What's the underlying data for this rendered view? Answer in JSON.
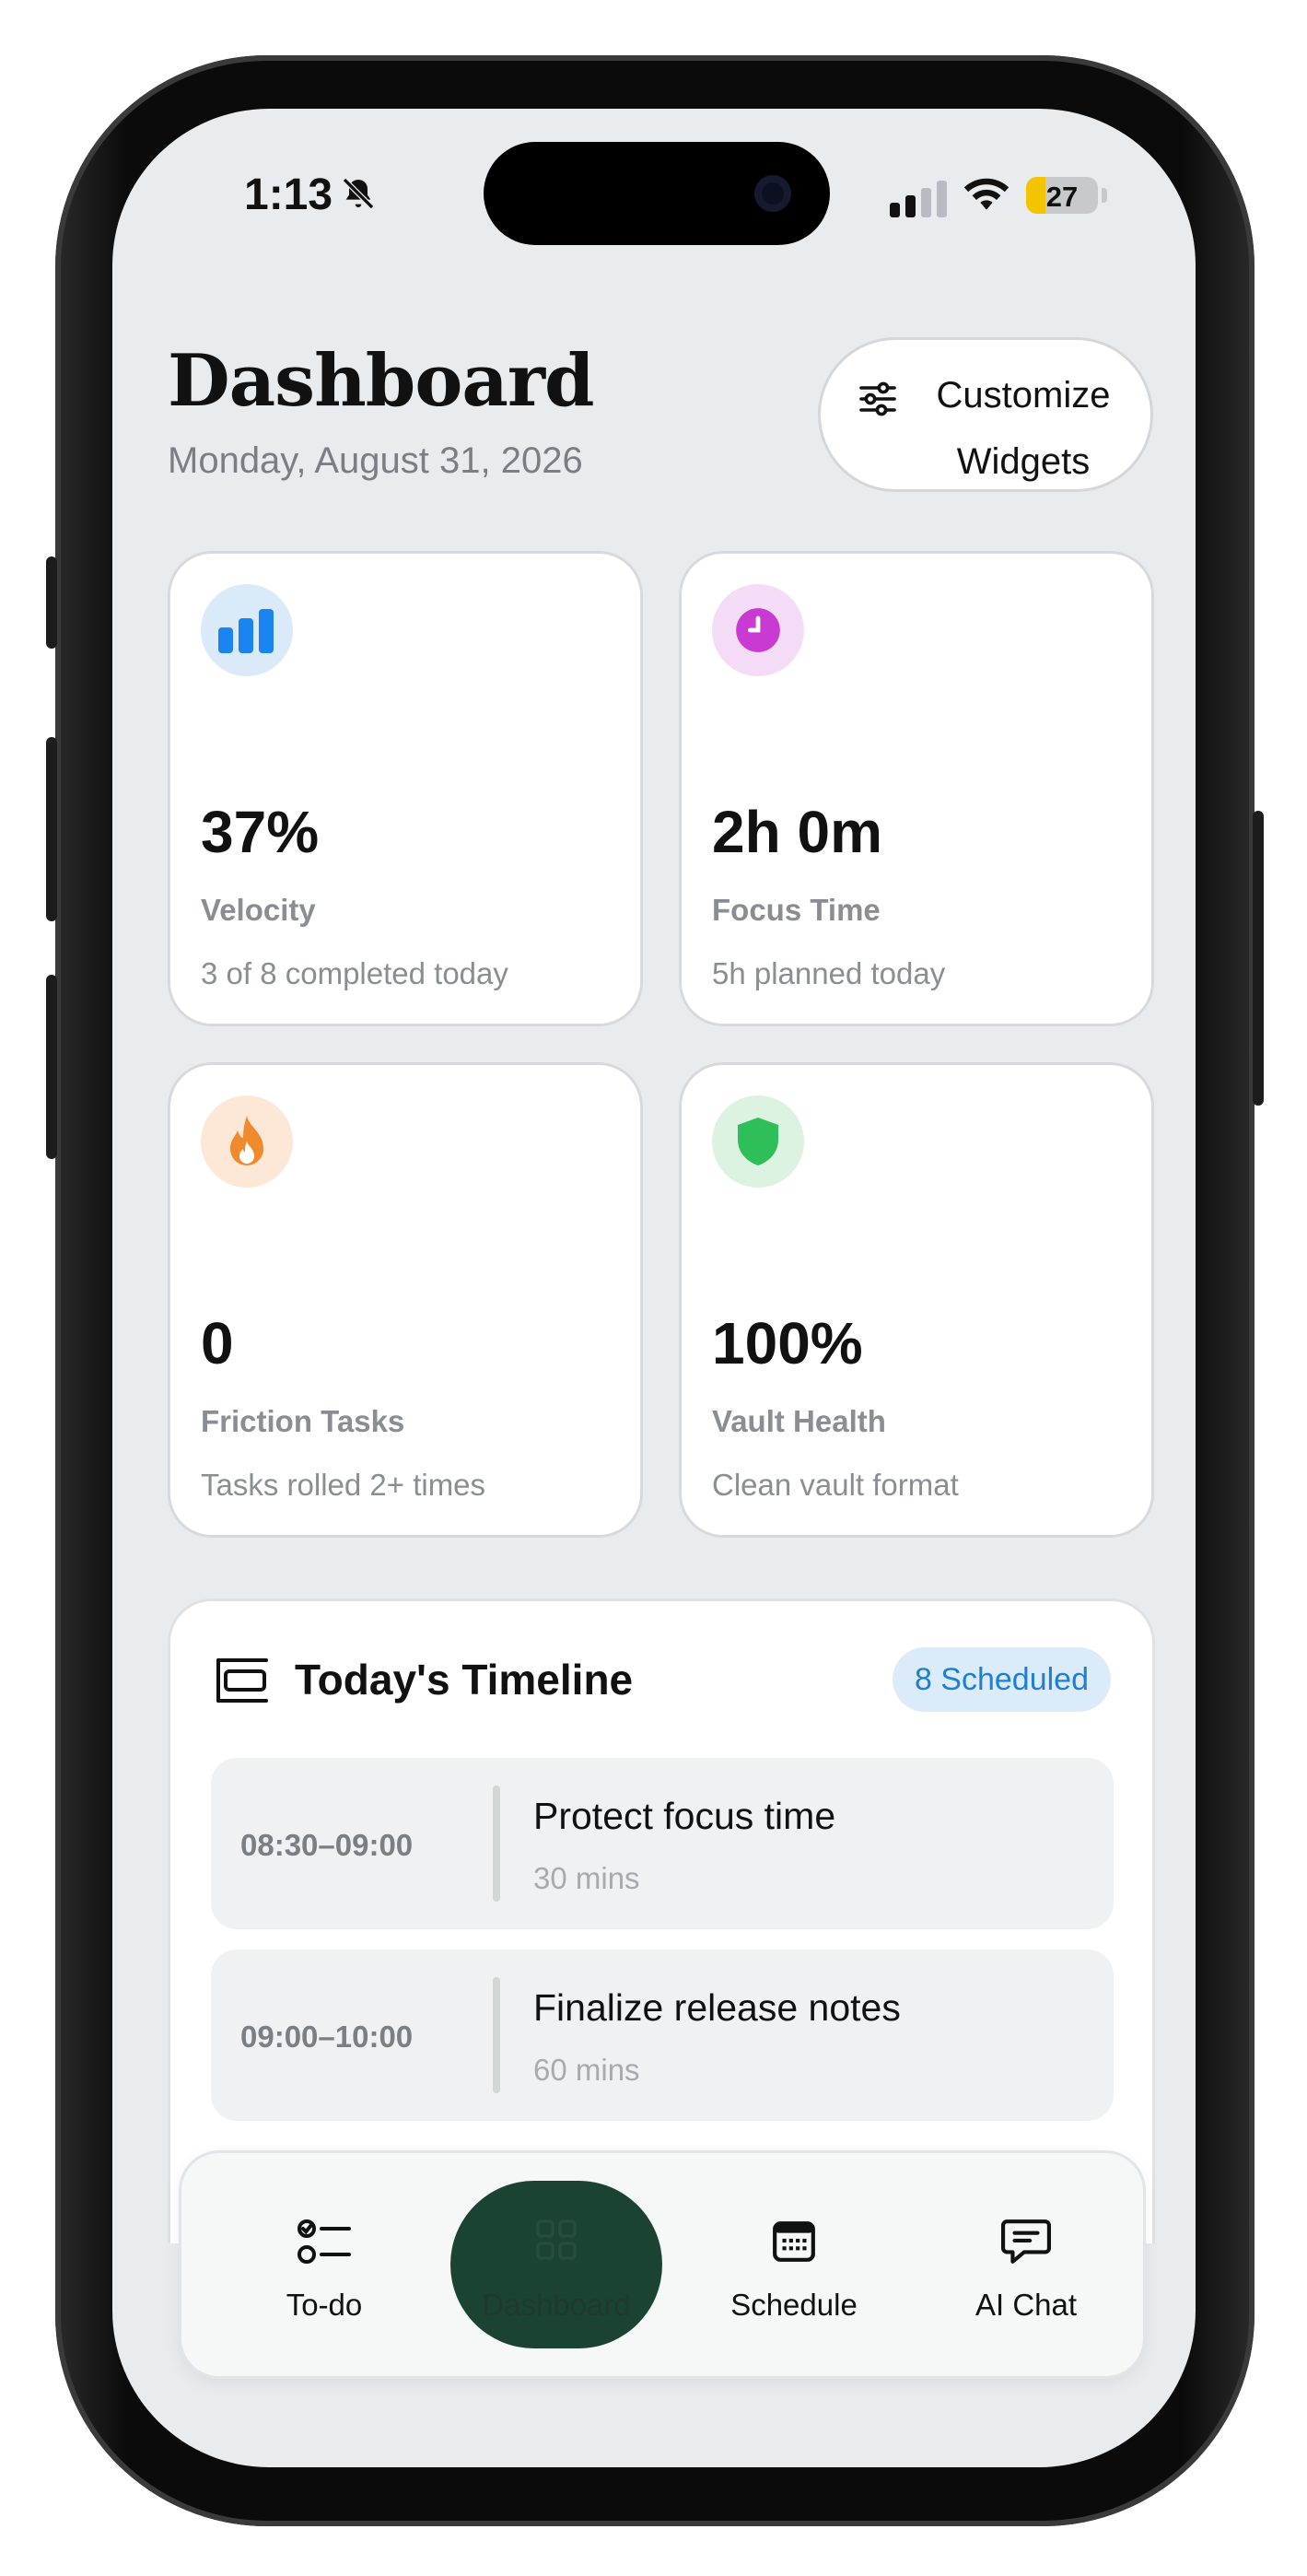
{
  "status_bar": {
    "time": "1:13",
    "battery": "27",
    "battery_fraction": 0.27,
    "icons": [
      "bell-muted-icon",
      "cellular-signal-icon",
      "wifi-icon",
      "battery-icon"
    ]
  },
  "header": {
    "title": "Dashboard",
    "date": "Monday, August 31, 2026",
    "customize_label": "Customize Widgets"
  },
  "cards": [
    {
      "value": "37%",
      "label": "Velocity",
      "sub": "3 of 8 completed today",
      "icon": "bar-chart-icon",
      "accent": "#1a84f0",
      "tint": "#dbeaf9"
    },
    {
      "value": "2h 0m",
      "label": "Focus Time",
      "sub": "5h planned today",
      "icon": "clock-icon",
      "accent": "#c83ad1",
      "tint": "#f5dcf6"
    },
    {
      "value": "0",
      "label": "Friction Tasks",
      "sub": "Tasks rolled 2+ times",
      "icon": "flame-icon",
      "accent": "#f08a2c",
      "tint": "#fde7d6"
    },
    {
      "value": "100%",
      "label": "Vault Health",
      "sub": "Clean vault format",
      "icon": "shield-icon",
      "accent": "#2fbf58",
      "tint": "#dcf3e1"
    }
  ],
  "timeline": {
    "title": "Today's Timeline",
    "badge": "8 Scheduled",
    "items": [
      {
        "time": "08:30–09:00",
        "name": "Protect focus time",
        "duration": "30 mins"
      },
      {
        "time": "09:00–10:00",
        "name": "Finalize release notes",
        "duration": "60 mins"
      }
    ]
  },
  "tabbar": {
    "tabs": [
      {
        "label": "To-do",
        "icon": "checklist-icon",
        "active": false
      },
      {
        "label": "Dashboard",
        "icon": "grid-icon",
        "active": true
      },
      {
        "label": "Schedule",
        "icon": "calendar-icon",
        "active": false
      },
      {
        "label": "AI Chat",
        "icon": "chat-bubble-icon",
        "active": false
      }
    ]
  },
  "colors": {
    "background": "#e9ecef",
    "active_tab": "#1b4332",
    "badge_text": "#1f7fd2"
  }
}
